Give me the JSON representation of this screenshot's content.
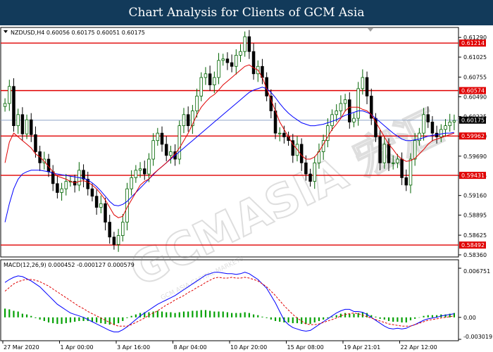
{
  "banner": {
    "title": "Chart Analysis for Clients of GCM Asia"
  },
  "watermark": {
    "text": "GCMASIA 宏汇",
    "subtext": "GCM ASIA CAPITAL MARKETS"
  },
  "price_panel": {
    "info": "NZDUSD,H4  0.60056 0.60175 0.60051 0.60175"
  },
  "macd_panel": {
    "info": "MACD(12,26,9) 0.000452 -0.000127 0.000579"
  },
  "colors": {
    "up_candle": "#006400",
    "down_candle": "#000000",
    "level_line": "#e00000",
    "level_label_bg": "#e00000",
    "ma_fast": "#e00000",
    "ma_slow": "#0000ff",
    "current_price_line": "#8fa6c8",
    "macd_hist": "#00a000",
    "macd_main": "#0000ff",
    "macd_signal": "#e00000",
    "banner_bg": "#123a5a"
  },
  "chart_data": [
    {
      "type": "candlestick",
      "symbol": "NZDUSD",
      "timeframe": "H4",
      "ylim": [
        0.5836,
        0.6132
      ],
      "y_ticks": [
        "0.61290",
        "0.61025",
        "0.60755",
        "0.60490",
        "0.60225",
        "0.59960",
        "0.59690",
        "0.59425",
        "0.59160",
        "0.58895",
        "0.58625",
        "0.58360"
      ],
      "x_labels": [
        "27 Mar 2020",
        "1 Apr 00:00",
        "3 Apr 16:00",
        "8 Apr 04:00",
        "10 Apr 20:00",
        "15 Apr 08:00",
        "19 Apr 21:01",
        "22 Apr 12:00"
      ],
      "levels": [
        0.61214,
        0.60574,
        0.59962,
        0.59431,
        0.58492
      ],
      "level_labels": [
        "0.61214",
        "0.60574",
        "0.59962",
        "0.59431",
        "0.58492"
      ],
      "current_price": 0.60175,
      "current_price_label": "0.60175",
      "close": [
        0.604,
        0.6063,
        0.601,
        0.6025,
        0.5999,
        0.6018,
        0.5998,
        0.5975,
        0.596,
        0.5965,
        0.5948,
        0.5932,
        0.592,
        0.5925,
        0.5935,
        0.5935,
        0.593,
        0.595,
        0.5938,
        0.5925,
        0.5915,
        0.59,
        0.5905,
        0.588,
        0.586,
        0.585,
        0.5862,
        0.588,
        0.5925,
        0.594,
        0.595,
        0.5952,
        0.5945,
        0.5965,
        0.599,
        0.6,
        0.5985,
        0.597,
        0.5975,
        0.5965,
        0.601,
        0.6025,
        0.601,
        0.603,
        0.605,
        0.6075,
        0.608,
        0.6065,
        0.6075,
        0.6098,
        0.61,
        0.6095,
        0.609,
        0.6105,
        0.611,
        0.613,
        0.611,
        0.608,
        0.609,
        0.6075,
        0.605,
        0.603,
        0.6,
        0.6,
        0.5995,
        0.599,
        0.597,
        0.5985,
        0.596,
        0.5945,
        0.5935,
        0.596,
        0.5975,
        0.599,
        0.601,
        0.6025,
        0.603,
        0.604,
        0.6045,
        0.6015,
        0.602,
        0.606,
        0.6075,
        0.605,
        0.602,
        0.5995,
        0.596,
        0.5985,
        0.596,
        0.596,
        0.5965,
        0.594,
        0.593,
        0.5965,
        0.599,
        0.6,
        0.6025,
        0.6015,
        0.6,
        0.5995,
        0.6005,
        0.601,
        0.6015,
        0.6017
      ],
      "ma_fast": [
        0.596,
        0.5988,
        0.6,
        0.5995,
        0.599,
        0.5985,
        0.598,
        0.5972,
        0.5968,
        0.5962,
        0.5955,
        0.5948,
        0.5942,
        0.594,
        0.5938,
        0.5935,
        0.5933,
        0.5935,
        0.5936,
        0.5934,
        0.593,
        0.5925,
        0.5918,
        0.591,
        0.59,
        0.589,
        0.5886,
        0.5888,
        0.59,
        0.591,
        0.592,
        0.593,
        0.5935,
        0.5938,
        0.5945,
        0.595,
        0.5955,
        0.596,
        0.5966,
        0.5972,
        0.598,
        0.599,
        0.6,
        0.6012,
        0.6025,
        0.6035,
        0.6042,
        0.6048,
        0.6052,
        0.6058,
        0.6065,
        0.607,
        0.6075,
        0.608,
        0.6085,
        0.609,
        0.6092,
        0.6088,
        0.6085,
        0.6075,
        0.606,
        0.6045,
        0.603,
        0.6015,
        0.6005,
        0.5995,
        0.5985,
        0.5978,
        0.597,
        0.5965,
        0.5965,
        0.5968,
        0.5975,
        0.5985,
        0.5995,
        0.6005,
        0.6012,
        0.602,
        0.603,
        0.6035,
        0.6035,
        0.6035,
        0.6032,
        0.603,
        0.6025,
        0.6015,
        0.6005,
        0.5995,
        0.5985,
        0.5978,
        0.597,
        0.5965,
        0.5962,
        0.5963,
        0.5966,
        0.5972,
        0.5978,
        0.5985,
        0.599,
        0.5992,
        0.5994,
        0.5996,
        0.5998,
        0.6
      ],
      "ma_slow": [
        0.588,
        0.5905,
        0.5925,
        0.5938,
        0.5945,
        0.5948,
        0.595,
        0.595,
        0.595,
        0.5949,
        0.5948,
        0.5946,
        0.5945,
        0.5944,
        0.5943,
        0.5942,
        0.5941,
        0.594,
        0.5939,
        0.5937,
        0.5933,
        0.5928,
        0.5922,
        0.5915,
        0.5908,
        0.5903,
        0.5902,
        0.5904,
        0.5908,
        0.5914,
        0.592,
        0.5926,
        0.5932,
        0.5938,
        0.5944,
        0.595,
        0.5955,
        0.596,
        0.5965,
        0.597,
        0.5975,
        0.598,
        0.5985,
        0.599,
        0.5995,
        0.6,
        0.6005,
        0.601,
        0.6015,
        0.602,
        0.6025,
        0.603,
        0.6035,
        0.604,
        0.6045,
        0.605,
        0.6055,
        0.6058,
        0.606,
        0.6062,
        0.606,
        0.6055,
        0.6048,
        0.604,
        0.6033,
        0.6027,
        0.6022,
        0.6018,
        0.6014,
        0.6012,
        0.601,
        0.601,
        0.6011,
        0.6012,
        0.6014,
        0.6016,
        0.6018,
        0.6021,
        0.6024,
        0.6026,
        0.6028,
        0.603,
        0.603,
        0.6028,
        0.6025,
        0.602,
        0.6015,
        0.601,
        0.6005,
        0.6,
        0.5996,
        0.5992,
        0.599,
        0.599,
        0.5991,
        0.5992,
        0.5994,
        0.5996,
        0.5997,
        0.5998,
        0.5999,
        0.6,
        0.6,
        0.6001
      ]
    },
    {
      "type": "macd",
      "params": "12,26,9",
      "ylim": [
        -0.003019,
        0.006751
      ],
      "y_ticks": [
        "0.006751",
        "0.00",
        "-0.003019"
      ],
      "histogram": [
        0.0012,
        0.0011,
        0.0009,
        0.0008,
        0.0005,
        0.0004,
        0.0002,
        -0.0001,
        -0.0003,
        -0.0005,
        -0.0007,
        -0.0008,
        -0.0009,
        -0.0009,
        -0.0008,
        -0.0007,
        -0.0006,
        -0.0005,
        -0.0005,
        -0.0005,
        -0.0006,
        -0.0007,
        -0.0008,
        -0.0009,
        -0.001,
        -0.001,
        -0.0008,
        -0.0005,
        -0.0001,
        0.0002,
        0.0004,
        0.0006,
        0.0007,
        0.0007,
        0.0008,
        0.0009,
        0.0008,
        0.0007,
        0.0007,
        0.0006,
        0.0007,
        0.0008,
        0.0008,
        0.0009,
        0.0009,
        0.001,
        0.001,
        0.0009,
        0.0008,
        0.0008,
        0.0008,
        0.0007,
        0.0006,
        0.0006,
        0.0006,
        0.0007,
        0.0006,
        0.0004,
        0.0003,
        0.0001,
        -0.0001,
        -0.0003,
        -0.0005,
        -0.0006,
        -0.0007,
        -0.0007,
        -0.0008,
        -0.0008,
        -0.0009,
        -0.0009,
        -0.0009,
        -0.0007,
        -0.0005,
        -0.0003,
        -0.0001,
        0.0001,
        0.0003,
        0.0005,
        0.0006,
        0.0005,
        0.0005,
        0.0006,
        0.0007,
        0.0006,
        0.0003,
        0.0001,
        -0.0002,
        -0.0003,
        -0.0005,
        -0.0006,
        -0.0006,
        -0.0007,
        -0.0007,
        -0.0004,
        -0.0002,
        0.0,
        0.0002,
        0.0003,
        0.0003,
        0.0003,
        0.0004,
        0.0004,
        0.0005,
        0.0006
      ],
      "main": [
        0.0048,
        0.0052,
        0.0055,
        0.0057,
        0.0056,
        0.0053,
        0.005,
        0.0046,
        0.0042,
        0.0036,
        0.003,
        0.0024,
        0.0018,
        0.0014,
        0.001,
        0.0006,
        0.0004,
        0.0002,
        0.0,
        -0.0003,
        -0.0006,
        -0.0009,
        -0.0012,
        -0.0015,
        -0.0018,
        -0.002,
        -0.002,
        -0.0017,
        -0.0013,
        -0.0008,
        -0.0003,
        0.0002,
        0.0006,
        0.001,
        0.0014,
        0.0018,
        0.0021,
        0.0024,
        0.0027,
        0.003,
        0.0034,
        0.0038,
        0.0042,
        0.0046,
        0.005,
        0.0054,
        0.0058,
        0.006,
        0.0062,
        0.0062,
        0.0061,
        0.006,
        0.006,
        0.0059,
        0.006,
        0.0062,
        0.006,
        0.0056,
        0.0052,
        0.0046,
        0.004,
        0.003,
        0.002,
        0.0008,
        -0.0004,
        -0.001,
        -0.0014,
        -0.0016,
        -0.0018,
        -0.0019,
        -0.0018,
        -0.0014,
        -0.001,
        -0.0006,
        -0.0002,
        0.0002,
        0.0006,
        0.0009,
        0.0011,
        0.0011,
        0.0008,
        0.0008,
        0.0007,
        0.0004,
        0.0,
        -0.0004,
        -0.0008,
        -0.0012,
        -0.0015,
        -0.0016,
        -0.0015,
        -0.0016,
        -0.0015,
        -0.0012,
        -0.001,
        -0.0007,
        -0.0004,
        -0.0002,
        -0.0001,
        0.0,
        0.0002,
        0.0003,
        0.0004,
        0.0005
      ],
      "signal": [
        0.0036,
        0.0041,
        0.0046,
        0.0049,
        0.0051,
        0.0052,
        0.0052,
        0.0051,
        0.0049,
        0.0046,
        0.0043,
        0.0039,
        0.0035,
        0.0031,
        0.0027,
        0.0023,
        0.0019,
        0.0015,
        0.0012,
        0.0008,
        0.0005,
        0.0002,
        -0.0001,
        -0.0004,
        -0.0007,
        -0.001,
        -0.0012,
        -0.0012,
        -0.0012,
        -0.001,
        -0.0007,
        -0.0004,
        -0.0001,
        0.0003,
        0.0006,
        0.0009,
        0.0013,
        0.0017,
        0.002,
        0.0024,
        0.0027,
        0.003,
        0.0034,
        0.0037,
        0.0041,
        0.0044,
        0.0048,
        0.0051,
        0.0054,
        0.0055,
        0.0054,
        0.0054,
        0.0055,
        0.0054,
        0.0054,
        0.0055,
        0.0054,
        0.0052,
        0.005,
        0.0046,
        0.0042,
        0.0036,
        0.003,
        0.0023,
        0.0016,
        0.001,
        0.0004,
        -0.0001,
        -0.0005,
        -0.0009,
        -0.001,
        -0.001,
        -0.0009,
        -0.0007,
        -0.0005,
        -0.0003,
        -0.0001,
        0.0002,
        0.0004,
        0.0005,
        0.0006,
        0.0005,
        0.0003,
        0.0001,
        -0.0001,
        -0.0003,
        -0.0005,
        -0.0007,
        -0.0009,
        -0.001,
        -0.0011,
        -0.0012,
        -0.0012,
        -0.0012,
        -0.001,
        -0.0008,
        -0.0006,
        -0.0004,
        -0.0003,
        -0.0002,
        -0.0001,
        0.0,
        0.0001,
        0.0002
      ]
    }
  ]
}
